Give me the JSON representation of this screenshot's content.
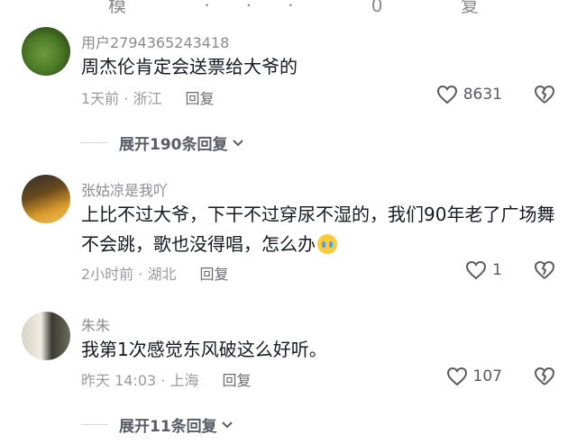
{
  "top_fragment": "模 ··· 0 复",
  "comments": [
    {
      "username": "用户2794365243418",
      "text": "周杰伦肯定会送票给大爷的",
      "time_loc": "1天前 · 浙江",
      "reply_label": "回复",
      "likes": "8631"
    },
    {
      "username": "张姑凉是我吖",
      "text": "上比不过大爷，下干不过穿尿不湿的，我们90年老了广场舞不会跳，歌也没得唱，怎么办",
      "time_loc": "2小时前 · 湖北",
      "reply_label": "回复",
      "likes": "1"
    },
    {
      "username": "朱朱",
      "text": "我第1次感觉东风破这么好听。",
      "time_loc": "昨天 14:03 · 上海",
      "reply_label": "回复",
      "likes": "107"
    }
  ],
  "expanders": [
    {
      "label": "展开190条回复"
    },
    {
      "label": "展开11条回复"
    }
  ],
  "icons": {
    "like": "heart-outline-icon",
    "dislike": "broken-heart-icon",
    "expand": "chevron-down-icon",
    "emoji": "crying-face-emoji"
  }
}
